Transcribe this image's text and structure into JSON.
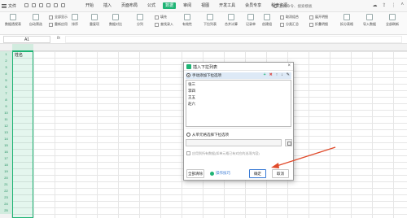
{
  "titlebar": {
    "file_label": "文件",
    "tabs": [
      "开始",
      "插入",
      "页面布局",
      "公式",
      "数据",
      "审阅",
      "视图",
      "开发工具",
      "会员专享",
      "稻壳资源"
    ],
    "active_tab": "数据",
    "search_text": "查找命令、搜索模板"
  },
  "ribbon": {
    "groups": [
      "数据透视表",
      "自动筛选",
      "全部显示",
      "重新应用",
      "排序",
      "重复项",
      "数据对比",
      "分列",
      "填充",
      "查找录入",
      "有效性",
      "下拉列表",
      "合并计算",
      "记录单",
      "创建组",
      "取消组合",
      "分类汇总",
      "展开明细",
      "折叠明细",
      "拆分表格",
      "导入数据",
      "全部刷新"
    ]
  },
  "formula_bar": {
    "cell_ref": "A1",
    "fx": "fx"
  },
  "grid": {
    "a1_value": "姓名",
    "row_numbers": [
      "1",
      "2",
      "3",
      "4",
      "5",
      "6",
      "7",
      "8",
      "9",
      "10",
      "11",
      "12",
      "13",
      "14",
      "15",
      "16",
      "17",
      "18",
      "19",
      "20",
      "21",
      "22",
      "23",
      "24",
      "25"
    ]
  },
  "dialog": {
    "title": "插入下拉列表",
    "close": "×",
    "manual_option": "手动添加下拉选项",
    "tools": {
      "add": "+",
      "delete": "✖",
      "up": "↑",
      "down": "↓",
      "edit": "✎"
    },
    "items": [
      "张三",
      "李四",
      "王五",
      "赵六"
    ],
    "cell_option": "从单元格选择下拉选项",
    "checkbox_label": "应用到所有数据(如单元格已有对应的选项内容)",
    "clear_all": "全部清除",
    "skill_link": "操作技巧",
    "ok": "确定",
    "cancel": "取消"
  },
  "colors": {
    "accent": "#1fb475",
    "arrow": "#e04a2a",
    "selection_bg": "#dde9f6"
  }
}
